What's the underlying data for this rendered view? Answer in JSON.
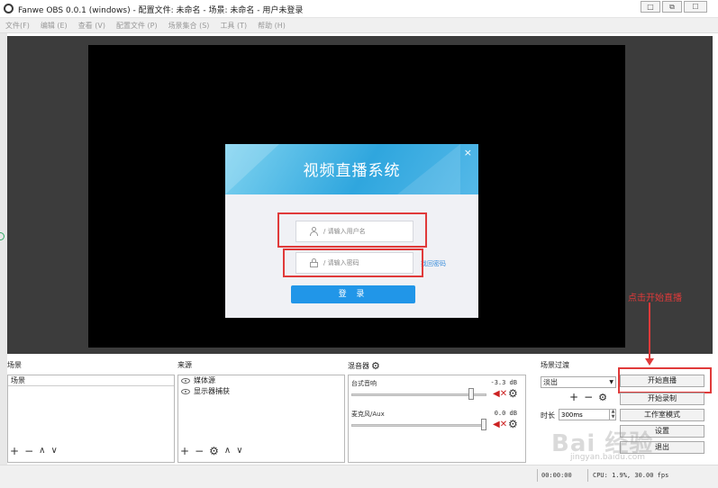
{
  "window": {
    "title": "Fanwe OBS 0.0.1 (windows) - 配置文件: 未命名 - 场景: 未命名 - 用户未登录",
    "minimize": "□",
    "maximize": "⧉",
    "close": "☐"
  },
  "menu": [
    "文件(F)",
    "编辑 (E)",
    "查看 (V)",
    "配置文件 (P)",
    "场景集合 (S)",
    "工具 (T)",
    "帮助 (H)"
  ],
  "login": {
    "title": "视频直播系统",
    "close": "×",
    "username_placeholder": "/ 请输入用户名",
    "password_placeholder": "/ 请输入密码",
    "forgot": "找回密码",
    "submit": "登 录"
  },
  "scenes": {
    "title": "场景",
    "items": [
      "场景"
    ]
  },
  "sources": {
    "title": "来源",
    "items": [
      "媒体源",
      "显示器捕获"
    ]
  },
  "mixer": {
    "title": "混音器",
    "channels": [
      {
        "name": "台式音响",
        "db": "-3.3 dB",
        "level": 0.9
      },
      {
        "name": "麦克风/Aux",
        "db": "0.0 dB",
        "level": 1.0
      }
    ]
  },
  "transitions": {
    "title": "场景过渡",
    "selected": "淡出",
    "duration_label": "时长",
    "duration_value": "300ms"
  },
  "controls": {
    "start_stream": "开始直播",
    "start_record": "开始录制",
    "studio_mode": "工作室模式",
    "settings": "设置",
    "exit": "退出"
  },
  "status": {
    "time": "00:00:00",
    "cpu": "CPU: 1.9%, 30.00 fps"
  },
  "annotation": "点击开始直播",
  "watermark": {
    "brand": "Bai 经验",
    "url": "jingyan.baidu.com"
  },
  "colors": {
    "annotation_red": "#e03a3a",
    "login_blue": "#2196e8"
  }
}
